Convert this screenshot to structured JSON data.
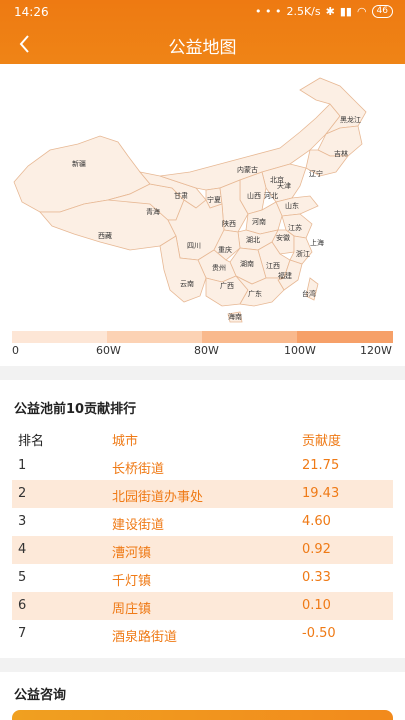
{
  "status": {
    "time": "14:26",
    "dots": "• • •",
    "speed": "2.5K/s",
    "battery": "46"
  },
  "header": {
    "title": "公益地图"
  },
  "map": {
    "provinces": [
      "黑龙江",
      "吉林",
      "辽宁",
      "内蒙古",
      "北京",
      "天津",
      "河北",
      "山西",
      "山东",
      "新疆",
      "甘肃",
      "宁夏",
      "陕西",
      "青海",
      "西藏",
      "四川",
      "重庆",
      "河南",
      "江苏",
      "安徽",
      "湖北",
      "上海",
      "浙江",
      "贵州",
      "湖南",
      "江西",
      "福建",
      "云南",
      "广西",
      "广东",
      "台湾",
      "海南"
    ],
    "legend": {
      "labels": [
        "0",
        "60W",
        "80W",
        "100W",
        "120W"
      ],
      "colors": [
        "#fde6d6",
        "#fcd2b4",
        "#f9b98d",
        "#f6a068"
      ]
    }
  },
  "ranking": {
    "title": "公益池前10贡献排行",
    "headers": [
      "排名",
      "城市",
      "贡献度"
    ],
    "rows": [
      {
        "rank": "1",
        "city": "长桥街道",
        "score": "21.75"
      },
      {
        "rank": "2",
        "city": "北园街道办事处",
        "score": "19.43"
      },
      {
        "rank": "3",
        "city": "建设街道",
        "score": "4.60"
      },
      {
        "rank": "4",
        "city": "漕河镇",
        "score": "0.92"
      },
      {
        "rank": "5",
        "city": "千灯镇",
        "score": "0.33"
      },
      {
        "rank": "6",
        "city": "周庄镇",
        "score": "0.10"
      },
      {
        "rank": "7",
        "city": "酒泉路街道",
        "score": "-0.50"
      }
    ]
  },
  "consult": {
    "title": "公益咨询"
  }
}
